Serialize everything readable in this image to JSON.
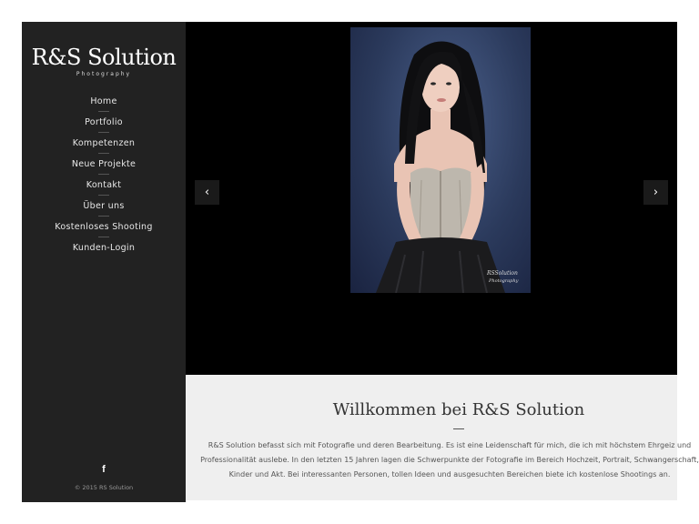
{
  "brand": {
    "title": "R&S Solution",
    "subtitle": "Photography"
  },
  "nav": {
    "items": [
      {
        "label": "Home"
      },
      {
        "label": "Portfolio"
      },
      {
        "label": "Kompetenzen"
      },
      {
        "label": "Neue Projekte"
      },
      {
        "label": "Kontakt"
      },
      {
        "label": "Über uns"
      },
      {
        "label": "Kostenloses Shooting"
      },
      {
        "label": "Kunden-Login"
      }
    ]
  },
  "social": {
    "facebook_glyph": "f",
    "icon": "facebook-icon"
  },
  "footer": {
    "copyright": "© 2015 RS Solution"
  },
  "slider": {
    "prev_glyph": "‹",
    "next_glyph": "›",
    "watermark": "RSSolution Photography"
  },
  "welcome": {
    "title": "Willkommen bei R&S Solution",
    "text": "R&S Solution befasst sich mit Fotografie und deren Bearbeitung. Es ist eine Leidenschaft für mich, die ich mit höchstem Ehrgeiz und Professionalität auslebe. In den letzten 15 Jahren lagen die Schwerpunkte der Fotografie im Bereich Hochzeit, Portrait, Schwangerschaft, Kinder und Akt. Bei interessanten Personen, tollen Ideen und ausgesuchten Bereichen biete ich kostenlose Shootings an."
  },
  "colors": {
    "sidebar": "#222222",
    "slider": "#000000",
    "welcome_bg": "#efefef",
    "photo_backdrop": "#2b3a5c"
  }
}
